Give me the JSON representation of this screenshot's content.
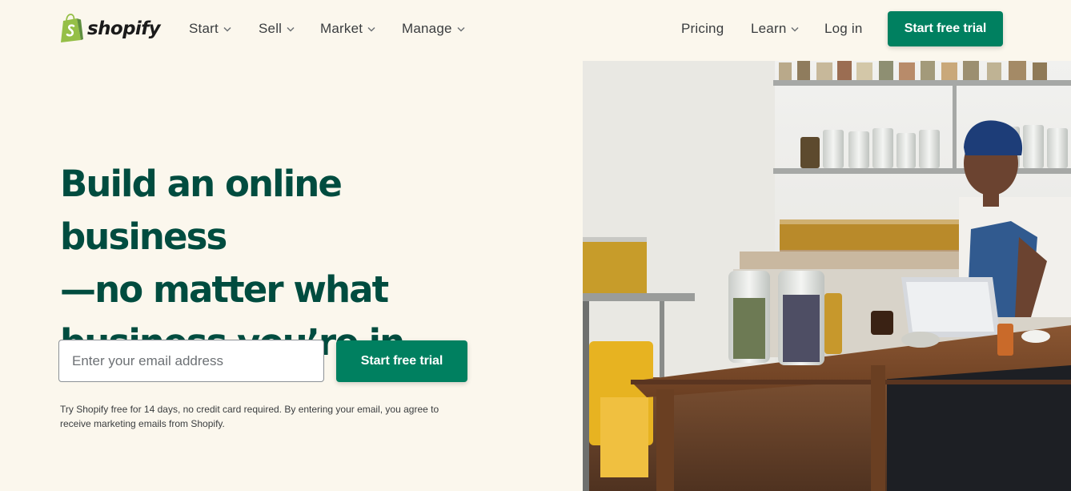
{
  "brand": {
    "name": "shopify",
    "color": "#95bf47"
  },
  "nav": {
    "items": [
      {
        "label": "Start",
        "has_dropdown": true
      },
      {
        "label": "Sell",
        "has_dropdown": true
      },
      {
        "label": "Market",
        "has_dropdown": true
      },
      {
        "label": "Manage",
        "has_dropdown": true
      }
    ],
    "right": {
      "pricing": "Pricing",
      "learn": "Learn",
      "login": "Log in",
      "cta": "Start free trial"
    }
  },
  "hero": {
    "headline_lines": [
      "Build an online business",
      "—no matter what",
      "business you’re in"
    ],
    "email_placeholder": "Enter your email address",
    "cta": "Start free trial",
    "disclaimer": "Try Shopify free for 14 days, no credit card required. By entering your email, you agree to receive marketing emails from Shopify."
  },
  "colors": {
    "background": "#fbf7ed",
    "accent": "#008060",
    "headline": "#004c3f"
  }
}
